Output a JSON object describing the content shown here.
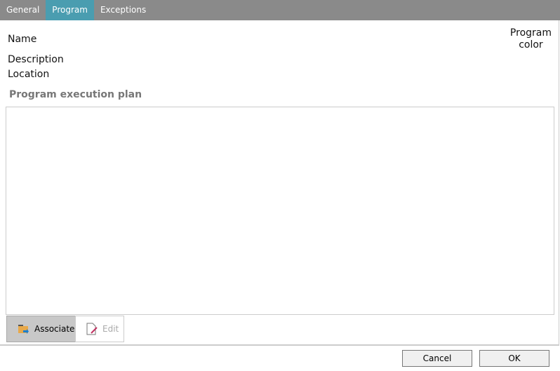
{
  "tabs": [
    {
      "label": "General"
    },
    {
      "label": "Program"
    },
    {
      "label": "Exceptions"
    }
  ],
  "fields": {
    "name": "Name",
    "description": "Description",
    "location": "Location",
    "color_line1": "Program",
    "color_line2": "color"
  },
  "plan": {
    "title": "Program execution plan",
    "associate": "Associate",
    "edit": "Edit"
  },
  "footer": {
    "cancel": "Cancel",
    "ok": "OK"
  }
}
